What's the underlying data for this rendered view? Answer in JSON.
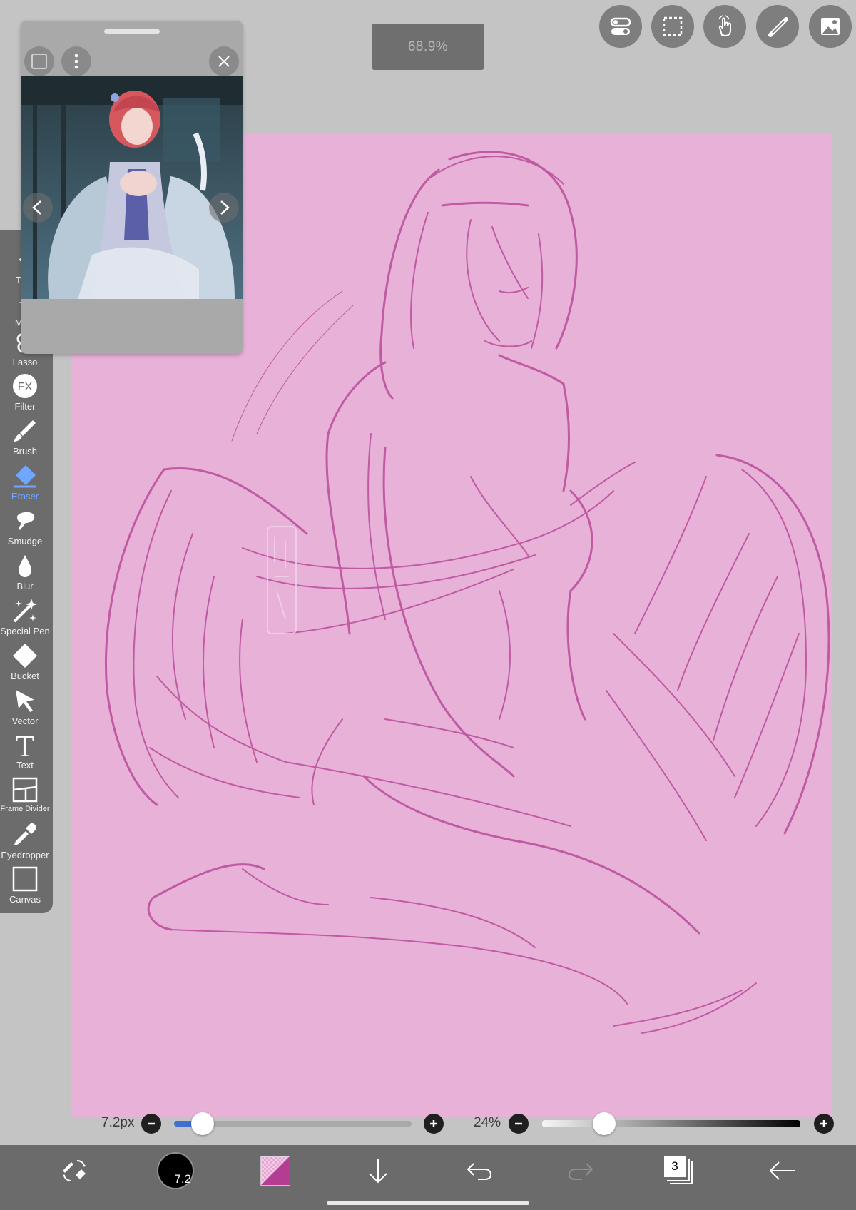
{
  "zoom": {
    "label": "68.9%"
  },
  "top_buttons": [
    {
      "name": "settings-toggle-icon"
    },
    {
      "name": "selection-icon"
    },
    {
      "name": "touch-gesture-icon"
    },
    {
      "name": "ruler-icon"
    },
    {
      "name": "image-material-icon"
    }
  ],
  "reference_window": {
    "nav_prev": "<",
    "nav_next": ">"
  },
  "tools": [
    {
      "label": "Tran",
      "icon": "transform-icon"
    },
    {
      "label": "Magi",
      "icon": "magic-wand-icon"
    },
    {
      "label": "Lasso",
      "icon": "lasso-icon"
    },
    {
      "label": "Filter",
      "icon": "filter-icon"
    },
    {
      "label": "Brush",
      "icon": "brush-icon"
    },
    {
      "label": "Eraser",
      "icon": "eraser-icon",
      "active": true
    },
    {
      "label": "Smudge",
      "icon": "smudge-icon"
    },
    {
      "label": "Blur",
      "icon": "blur-icon"
    },
    {
      "label": "Special Pen",
      "icon": "special-pen-icon"
    },
    {
      "label": "Bucket",
      "icon": "bucket-icon"
    },
    {
      "label": "Vector",
      "icon": "vector-icon"
    },
    {
      "label": "Text",
      "icon": "text-icon"
    },
    {
      "label": "Frame Divider",
      "icon": "frame-divider-icon"
    },
    {
      "label": "Eyedropper",
      "icon": "eyedropper-icon"
    },
    {
      "label": "Canvas",
      "icon": "canvas-icon"
    }
  ],
  "brush_size": {
    "label": "7.2px",
    "level": 0.12
  },
  "opacity": {
    "label": "24%",
    "level": 0.24
  },
  "bottom_bar": {
    "brush_badge": "7.2",
    "layers_count": "3"
  },
  "colors": {
    "canvas": "#e8b1d8",
    "sketch": "#b23d92",
    "active_tool": "#6fa6ff",
    "slider_fill": "#3f6fd1"
  }
}
